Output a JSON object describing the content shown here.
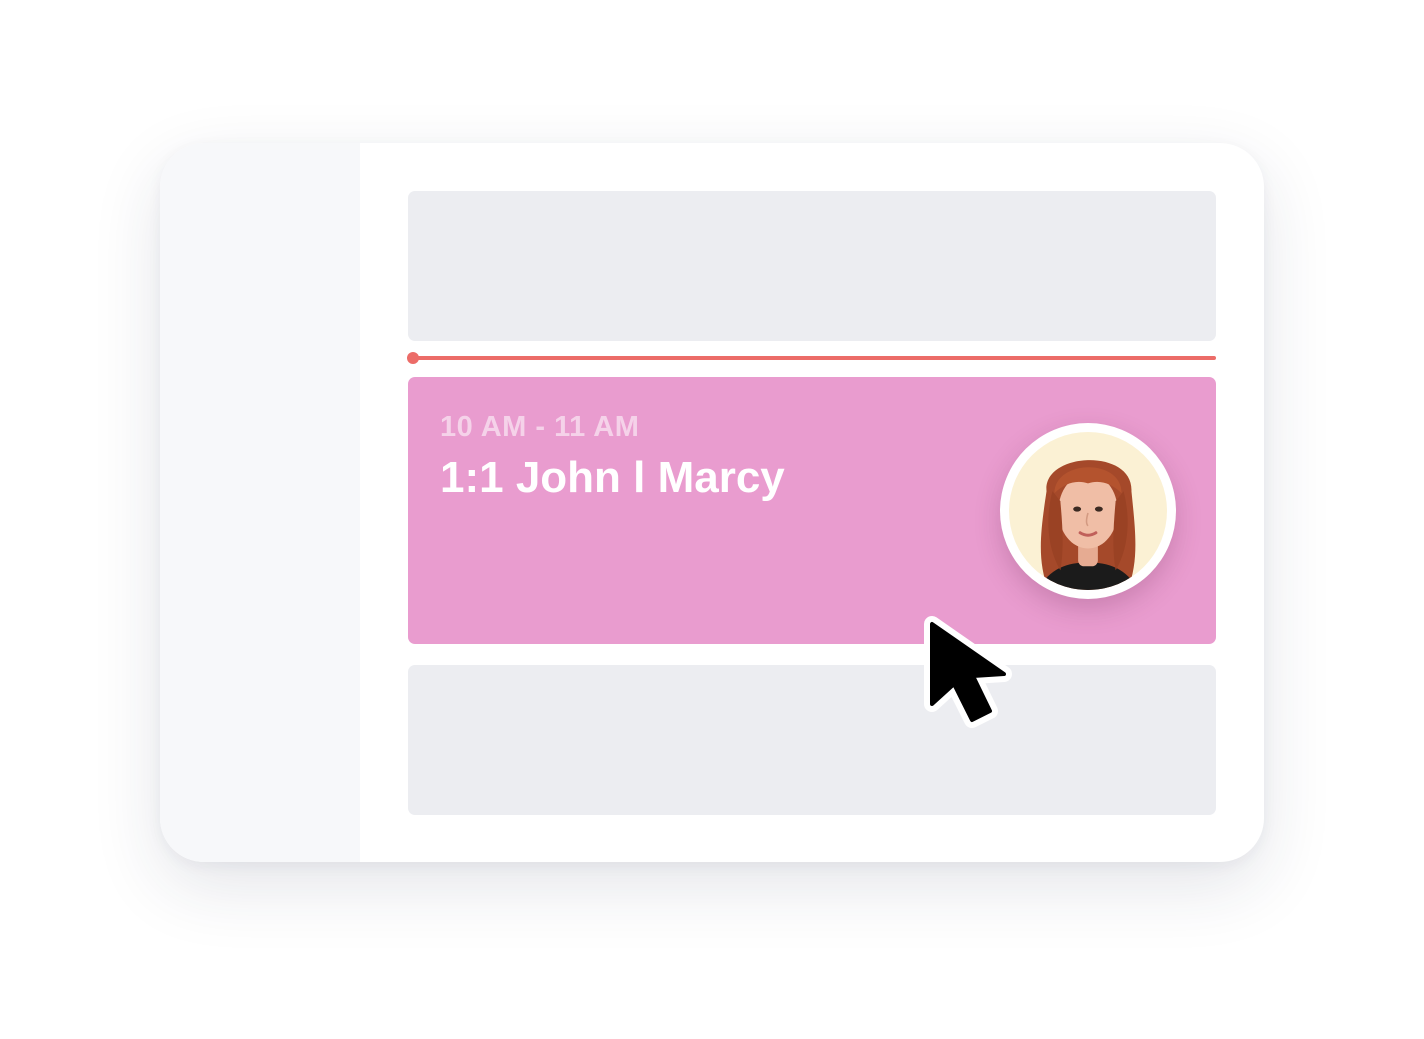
{
  "colors": {
    "sidebar": "#f7f8fa",
    "slot": "#ecedf1",
    "now_line": "#ec6c68",
    "event": "#e99ccf"
  },
  "event": {
    "time_range": "10 AM - 11 AM",
    "title": "1:1 John l Marcy"
  },
  "icons": {
    "avatar": "person-avatar-photo",
    "cursor": "mouse-pointer-icon"
  }
}
